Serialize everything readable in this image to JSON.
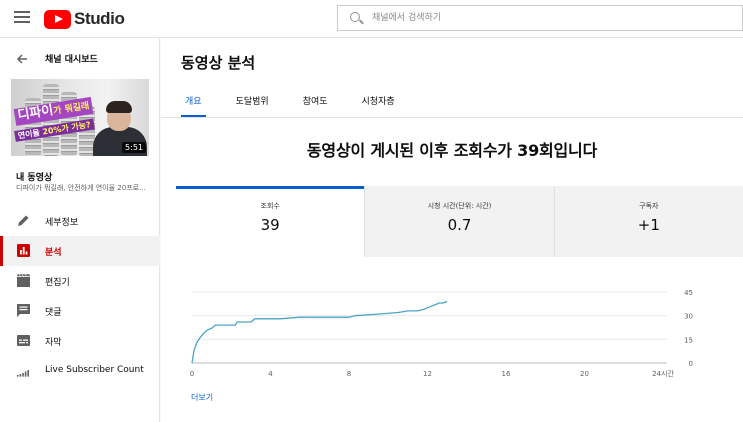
{
  "header": {
    "logo_text": "Studio",
    "search_placeholder": "채널에서 검색하기"
  },
  "sidebar": {
    "back_label": "채널 대시보드",
    "thumbnail": {
      "title_main": "디파이",
      "title_tail": "가 뭐길래",
      "subtitle_main": "연이율 ",
      "subtitle_highlight": "20%가 가능?",
      "duration": "5:51"
    },
    "my_video_label": "내 동영상",
    "video_title": "디파이가 뭐길래, 안전하게 연이율 20프로...",
    "items": [
      {
        "label": "세부정보",
        "icon": "pencil-icon",
        "active": false
      },
      {
        "label": "분석",
        "icon": "analytics-icon",
        "active": true
      },
      {
        "label": "편집기",
        "icon": "clapperboard-icon",
        "active": false
      },
      {
        "label": "댓글",
        "icon": "comment-icon",
        "active": false
      },
      {
        "label": "자막",
        "icon": "subtitles-icon",
        "active": false
      },
      {
        "label": "Live Subscriber Count",
        "icon": "signal-bars-icon",
        "active": false
      }
    ],
    "accent_color": "#cc0000"
  },
  "main": {
    "page_title": "동영상 분석",
    "tabs": [
      {
        "label": "개요",
        "active": true
      },
      {
        "label": "도달범위",
        "active": false
      },
      {
        "label": "참여도",
        "active": false
      },
      {
        "label": "시청자층",
        "active": false
      }
    ],
    "headline": "동영상이 게시된 이후 조회수가 39회입니다",
    "stats": [
      {
        "label": "조회수",
        "value": "39",
        "active": true
      },
      {
        "label": "시청 시간(단위: 시간)",
        "value": "0.7",
        "active": false
      },
      {
        "label": "구독자",
        "value": "+1",
        "active": false
      }
    ],
    "more_link": "더보기",
    "accent_color": "#065fd4"
  },
  "chart_data": {
    "type": "line",
    "title": "",
    "xlabel": "",
    "ylabel": "",
    "x_unit": "시간",
    "xlim": [
      0,
      24
    ],
    "ylim": [
      0,
      45
    ],
    "x_ticks": [
      0,
      4,
      8,
      12,
      16,
      20,
      24
    ],
    "y_ticks": [
      0,
      15,
      30,
      45
    ],
    "grid": true,
    "color": "#4da3c7",
    "series": [
      {
        "x": [
          0,
          0.1,
          0.25,
          0.4,
          0.6,
          0.8,
          1.0,
          1.2,
          1.5,
          2.2,
          2.3,
          3.0,
          3.2,
          4.5,
          5.5,
          7.0,
          8.0,
          8.3,
          9.5,
          10.5,
          11.0,
          11.5,
          11.8,
          12.0,
          12.2,
          12.4,
          12.6,
          12.8,
          13.0
        ],
        "y": [
          0,
          8,
          13,
          16,
          19,
          21,
          22,
          24,
          24,
          24,
          26,
          26,
          28,
          28,
          29,
          29,
          29,
          30,
          31,
          32,
          33,
          33,
          34,
          35,
          36,
          37,
          38,
          38,
          39
        ]
      }
    ]
  }
}
